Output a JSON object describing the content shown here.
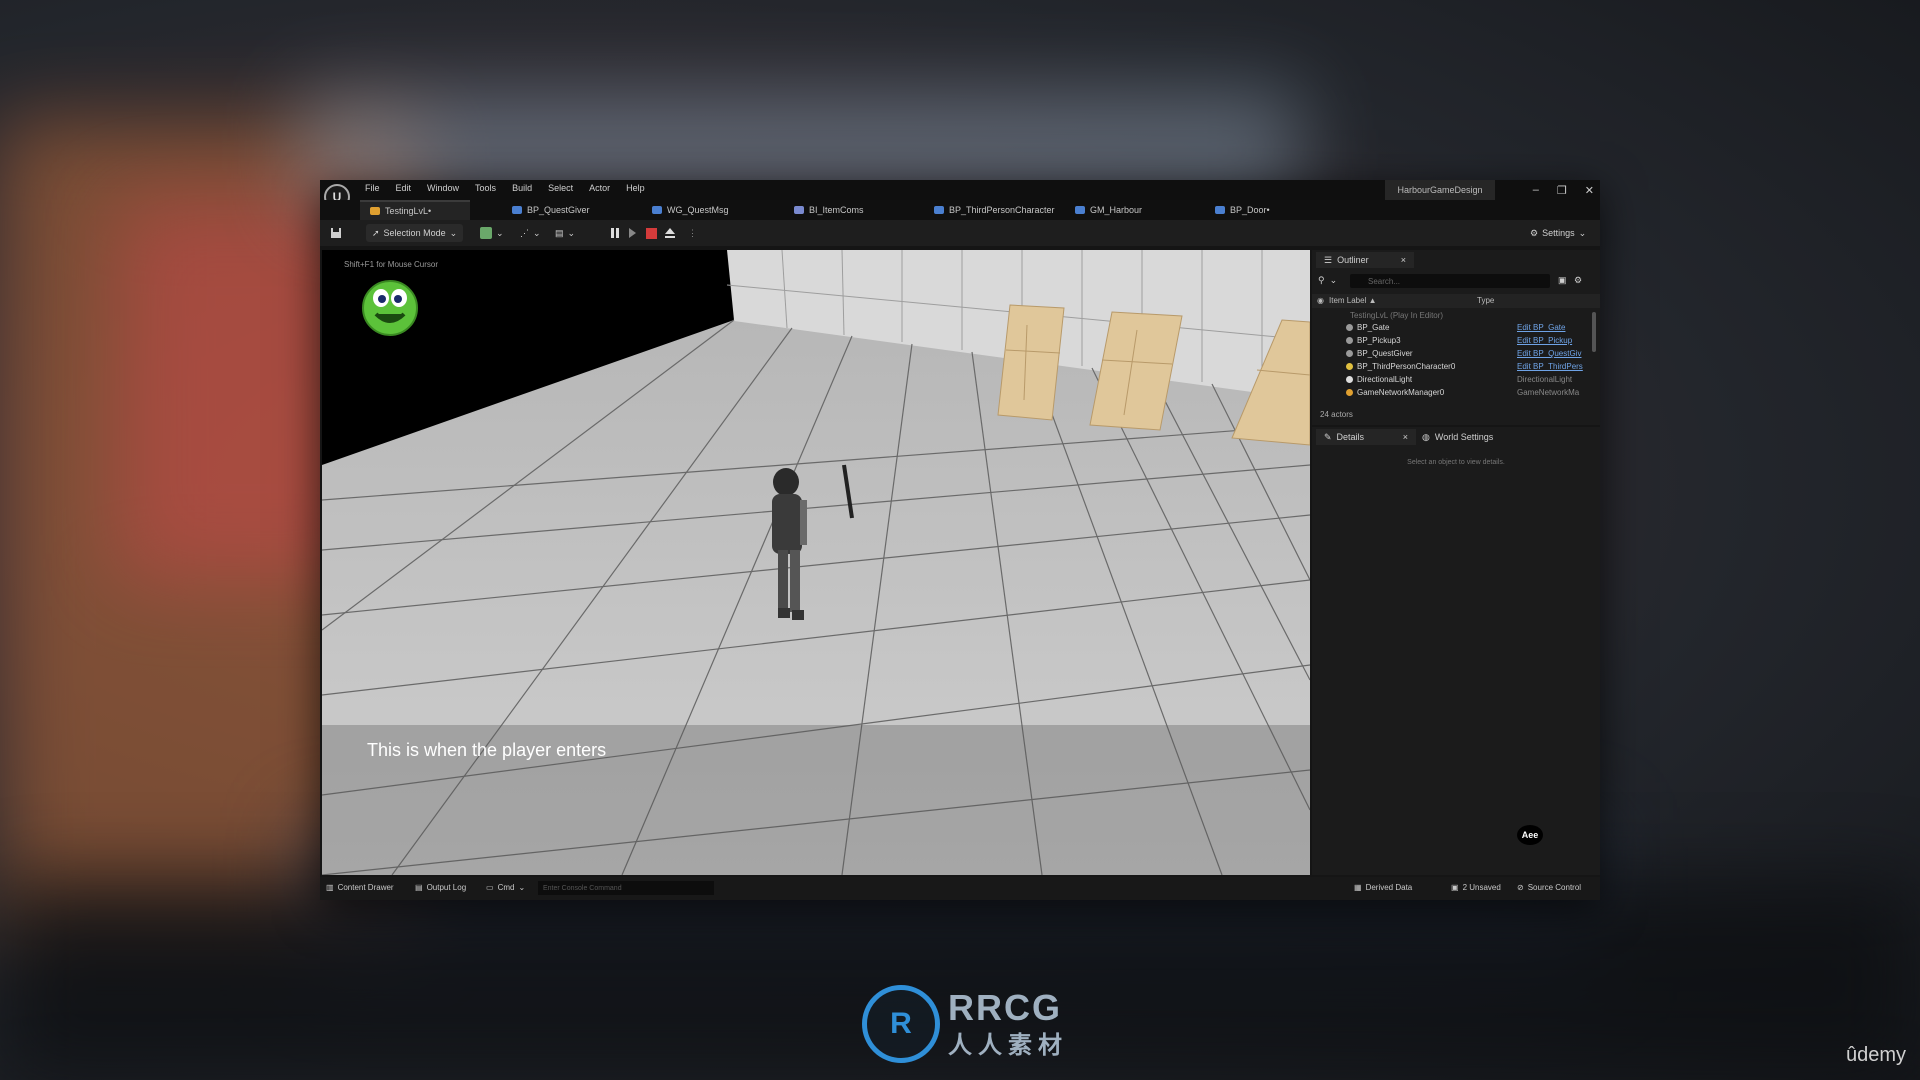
{
  "window": {
    "menu": [
      "File",
      "Edit",
      "Window",
      "Tools",
      "Build",
      "Select",
      "Actor",
      "Help"
    ],
    "project_name": "HarbourGameDesign",
    "controls": [
      "–",
      "❐",
      "✕"
    ]
  },
  "tabs": [
    {
      "label": "TestingLvL•",
      "active": true,
      "color": "#e0a030"
    },
    {
      "label": "BP_QuestGiver",
      "active": false,
      "color": "#4a7fd0"
    },
    {
      "label": "WG_QuestMsg",
      "active": false,
      "color": "#4a7fd0"
    },
    {
      "label": "BI_ItemComs",
      "active": false,
      "color": "#7a8ad0"
    },
    {
      "label": "BP_ThirdPersonCharacter",
      "active": false,
      "color": "#4a7fd0"
    },
    {
      "label": "GM_Harbour",
      "active": false,
      "color": "#4a7fd0"
    },
    {
      "label": "BP_Door•",
      "active": false,
      "color": "#4a7fd0"
    }
  ],
  "toolbar": {
    "selection_mode": "Selection Mode",
    "settings": "Settings"
  },
  "viewport": {
    "hint": "Shift+F1 for Mouse Cursor",
    "subtitle": "This is when the player enters"
  },
  "outliner": {
    "title": "Outliner",
    "search_placeholder": "Search...",
    "col_label": "Item Label ▲",
    "col_type": "Type",
    "root": "TestingLvL (Play In Editor)",
    "rows": [
      {
        "label": "BP_Gate",
        "type": "Edit BP_Gate",
        "link": true
      },
      {
        "label": "BP_Pickup3",
        "type": "Edit BP_Pickup",
        "link": true
      },
      {
        "label": "BP_QuestGiver",
        "type": "Edit BP_QuestGiv",
        "link": true
      },
      {
        "label": "BP_ThirdPersonCharacter0",
        "type": "Edit BP_ThirdPers",
        "link": true
      },
      {
        "label": "DirectionalLight",
        "type": "DirectionalLight",
        "link": false
      },
      {
        "label": "GameNetworkManager0",
        "type": "GameNetworkMa",
        "link": false
      }
    ],
    "count": "24 actors"
  },
  "details": {
    "tab_details": "Details",
    "tab_world": "World Settings",
    "empty_msg": "Select an object to view details.",
    "badge": "Aee"
  },
  "statusbar": {
    "content_drawer": "Content Drawer",
    "output_log": "Output Log",
    "cmd": "Cmd",
    "console_placeholder": "Enter Console Command",
    "derived_data": "Derived Data",
    "unsaved": "2 Unsaved",
    "source_control": "Source Control"
  },
  "watermark": {
    "brand": "RRCG",
    "brand_sub": "人人素材",
    "logo_letter": "R",
    "udemy": "ûdemy"
  }
}
